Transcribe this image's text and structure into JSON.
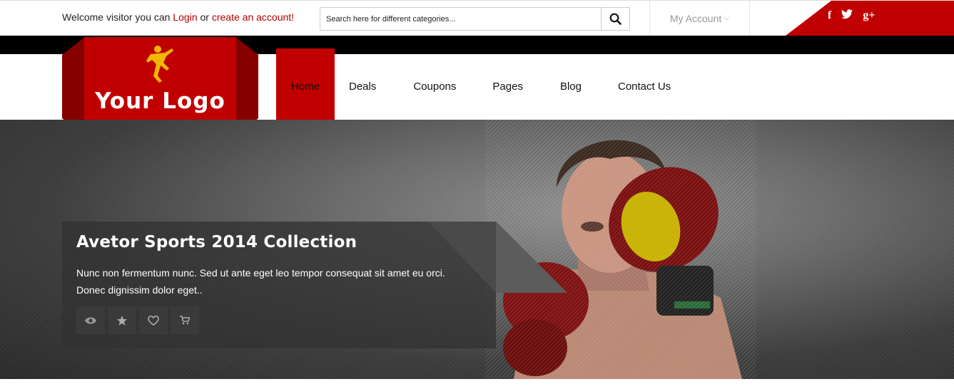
{
  "topbar": {
    "welcome_prefix": "Welcome visitor you can",
    "login_label": "Login",
    "or_text": "or",
    "create_account_label": "create an account!",
    "search_placeholder": "Search here for different categories...",
    "my_account_label": "My Account",
    "social": [
      "f",
      "t",
      "g+"
    ]
  },
  "logo": {
    "text": "Your Logo"
  },
  "nav": {
    "items": [
      {
        "label": "Home"
      },
      {
        "label": "Deals"
      },
      {
        "label": "Coupons"
      },
      {
        "label": "Pages"
      },
      {
        "label": "Blog"
      },
      {
        "label": "Contact Us"
      }
    ],
    "active_index": 0
  },
  "hero": {
    "title": "Avetor Sports 2014 Collection",
    "text": "Nunc non fermentum nunc. Sed ut ante eget leo tempor consequat sit amet eu orci. Donec dignissim dolor eget..",
    "actions": [
      "eye-icon",
      "star-icon",
      "heart-icon",
      "cart-icon"
    ]
  },
  "colors": {
    "brand_red": "#c00000",
    "dark_red": "#860000",
    "link_red": "#b20000"
  }
}
